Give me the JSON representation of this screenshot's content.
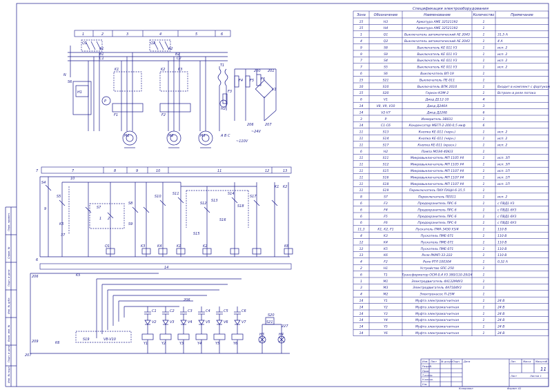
{
  "spec": {
    "title": "Спецификация электрооборудования",
    "headers": [
      "Зона",
      "Обозначение",
      "Наименование",
      "Количество",
      "Примечание"
    ],
    "rows": [
      [
        "15",
        "H3",
        "Арматура АМЕ 32521192",
        "1",
        ""
      ],
      [
        "15",
        "H4",
        "Арматура АМЕ 32521192",
        "1",
        ""
      ],
      [
        "1",
        "Q1",
        "Выключатель автоматический АЕ 2043",
        "1",
        "31,5 А"
      ],
      [
        "4",
        "Q2",
        "Выключатель автоматический АЕ 2043",
        "1",
        "4 А"
      ],
      [
        "9",
        "S8",
        "Выключатель КЕ 011 У3",
        "1",
        "исп. 2"
      ],
      [
        "9",
        "S9",
        "Выключатель КЕ 011 У3",
        "1",
        "исп. 2"
      ],
      [
        "7",
        "S4",
        "Выключатель КЕ 011 У3",
        "1",
        "исп. 2"
      ],
      [
        "7",
        "S5",
        "Выключатель КЕ 011 У3",
        "1",
        "исп. 2"
      ],
      [
        "6",
        "S6",
        "Выключатель ВП-19",
        "1",
        ""
      ],
      [
        "15",
        "S21",
        "Выключатель ПЕ-011",
        "1",
        ""
      ],
      [
        "10",
        "S10",
        "Выключатель ВПК 2010",
        "1",
        "Входит в комплект с фартуком"
      ],
      [
        "15",
        "S20",
        "Геркон КЭМ-2",
        "1",
        "Встроен в реле потока"
      ],
      [
        "6",
        "V1",
        "Диод Д112-10",
        "4",
        ""
      ],
      [
        "14",
        "V8, V9, V10",
        "Диод Д246А",
        "3",
        ""
      ],
      [
        "14",
        "V2-V7",
        "Диод Д226Б",
        "6",
        ""
      ],
      [
        "3",
        "P",
        "Измеритель ЭВ031",
        "1",
        ""
      ],
      [
        "14",
        "C1-C6",
        "Конденсатор МБГП-2-200-0,5 мкф",
        "6",
        ""
      ],
      [
        "11",
        "S13",
        "Кнопка КЕ-011 (черн.)",
        "1",
        "исп. 2"
      ],
      [
        "11",
        "S14",
        "Кнопка КЕ-011 (черн.)",
        "1",
        "исп. 2"
      ],
      [
        "11",
        "S17",
        "Кнопка КЕ-011 (красн.)",
        "1",
        "исп. 2"
      ],
      [
        "6",
        "H2",
        "Лампа МОЭ4-40Ю3",
        "1",
        ""
      ],
      [
        "11",
        "S11",
        "Микровыключатель МП 1105 У4",
        "1",
        "исп. 3П"
      ],
      [
        "11",
        "S12",
        "Микровыключатель МП 1105 У4",
        "1",
        "исп. 3П"
      ],
      [
        "11",
        "S15",
        "Микровыключатель МП 1107 У4",
        "1",
        "исп. 1П"
      ],
      [
        "11",
        "S16",
        "Микровыключатель МП 1107 У4",
        "1",
        "исп. 1П"
      ],
      [
        "11",
        "S18",
        "Микровыключатель МП 1107 У4",
        "1",
        "исп. 1П"
      ],
      [
        "11",
        "S19",
        "Переключатель ПКУ-ПАЦН-6-15,5",
        "1",
        ""
      ],
      [
        "8",
        "S7",
        "Переключатель ПЕ011",
        "1",
        "исп. 2"
      ],
      [
        "6",
        "F3",
        "Предохранитель ПРС-6",
        "1",
        "с ПВД1-У3"
      ],
      [
        "6",
        "F4",
        "Предохранитель ПРС-6",
        "1",
        "с ПВД1-6У3"
      ],
      [
        "6",
        "F5",
        "Предохранитель ПРС-6",
        "1",
        "с ПВД1-6У3"
      ],
      [
        "6",
        "F6",
        "Предохранитель ПРС-6",
        "1",
        "с ПВД1-6У3"
      ],
      [
        "11,3",
        "K1, K2, F1",
        "Пускатель ПМА 3430 У3/4",
        "1",
        "110 В"
      ],
      [
        "4",
        "K3",
        "Пускатель ПМЕ-071",
        "1",
        "110 В"
      ],
      [
        "12",
        "K4",
        "Пускатель ПМЕ-071",
        "1",
        "110 В"
      ],
      [
        "12",
        "K5",
        "Пускатель ПМЕ-071",
        "1",
        "110 В"
      ],
      [
        "13",
        "K6",
        "Реле РКМП-33-222",
        "1",
        "110 В"
      ],
      [
        "4",
        "F2",
        "Реле РТЛ 100304",
        "1",
        "0,32 А"
      ],
      [
        "2",
        "H1",
        "Устройство SПС-250",
        "1",
        ""
      ],
      [
        "6",
        "T1",
        "Трансформатор ОСМ-0,4 У3 380/110-29/24",
        "1",
        ""
      ],
      [
        "1",
        "M1",
        "Электродвигатель 4А132М4У3",
        "1",
        ""
      ],
      [
        "3",
        "M3",
        "Электродвигатель 4А71В4У3",
        "1",
        ""
      ],
      [
        "4",
        "M2",
        "Электронасос П-25М",
        "1",
        ""
      ],
      [
        "14",
        "Y1",
        "Муфта электромагнитная",
        "1",
        "24 В"
      ],
      [
        "14",
        "Y2",
        "Муфта электромагнитная",
        "1",
        "24 В"
      ],
      [
        "14",
        "Y3",
        "Муфта электромагнитная",
        "1",
        "24 В"
      ],
      [
        "14",
        "Y4",
        "Муфта электромагнитная",
        "1",
        "24 В"
      ],
      [
        "14",
        "Y5",
        "Муфта электромагнитная",
        "1",
        "24 В"
      ],
      [
        "14",
        "Y6",
        "Муфта электромагнитная",
        "1",
        "24 В"
      ]
    ]
  },
  "zones_top": [
    "1",
    "2",
    "3",
    "4",
    "5",
    "6"
  ],
  "zones_mid": [
    "7",
    "8",
    "9",
    "10",
    "11",
    "12",
    "13"
  ],
  "zones_bottom": [
    "14"
  ],
  "power_labels": {
    "q1": "Q1",
    "q2": "Q2",
    "a1": "А1",
    "b1": "В1",
    "c1": "С1",
    "a2": "А2",
    "b2": "В2",
    "c2": "С2",
    "m1": "М1",
    "m2": "М2",
    "m3": "М3",
    "t1": "T1",
    "h1": "Н1",
    "s6": "S6",
    "p": "P",
    "f3": "F3",
    "f4": "F4",
    "f5": "F5",
    "f6": "F6",
    "v1": "V1",
    "h2": "H2",
    "k1": "K1",
    "k2": "K2",
    "k3": "K3",
    "f1": "F1",
    "f2": "F2",
    "n200": "200",
    "n201": "201",
    "n206": "206",
    "n207": "207",
    "v110": "~110V",
    "v24": "~24V",
    "n": "N",
    "abc": "A B C"
  },
  "control_labels": {
    "s4": "S4",
    "s5": "S5",
    "s7": "S7",
    "s8": "S8",
    "s9": "S9",
    "s10": "S10",
    "s11": "S11",
    "s12": "S12",
    "s13": "S13",
    "s14": "S14",
    "s15": "S15",
    "s16": "S16",
    "s17": "S17",
    "s18": "S18",
    "k1": "K1",
    "k2": "K2",
    "k3": "K3",
    "k4": "K4",
    "k5": "K5",
    "k6": "K6",
    "q1": "Q1",
    "n1": "1",
    "n2": "2",
    "n7": "7",
    "n9": "9",
    "n10": "10",
    "n37": "37",
    "n6": "6"
  },
  "bottom_labels": {
    "n206": "206",
    "n207": "207",
    "n209": "209",
    "k5": "K5",
    "k6": "K6",
    "s19": "S19",
    "s20": "S20",
    "s21": "S21",
    "h3": "H3",
    "h4": "H4",
    "n227": "227",
    "c1": "C1",
    "c2": "C2",
    "c3": "C3",
    "c4": "C4",
    "c5": "C5",
    "c6": "C6",
    "y1": "Y1",
    "y2": "Y2",
    "y3": "Y3",
    "y4": "Y4",
    "y5": "Y5",
    "y6": "Y6",
    "v2": "V2",
    "v3": "V3",
    "v4": "V4",
    "v5": "V5",
    "v6": "V6",
    "v7": "V7",
    "v8": "V8-V10"
  },
  "side_stamp": [
    "Инв. № подл.",
    "Подп. и дата",
    "Взам. инв. №",
    "Инв. № дубл.",
    "Подп. и дата",
    "Справ. №",
    "Перв. примен."
  ],
  "title_block": {
    "sheet": "11",
    "lit": "Лит.",
    "mass": "Масса",
    "scale": "Масштаб",
    "sheet_label": "Лист",
    "sheets_label": "Листов 1",
    "copied": "Копировал",
    "format": "Формат   А1",
    "rows": [
      "Изм.",
      "Разраб.",
      "Пров.",
      "Т.контр.",
      "Н.контр.",
      "Утв."
    ],
    "cols": [
      "Лист",
      "№ докум.",
      "Подп.",
      "Дата"
    ]
  }
}
